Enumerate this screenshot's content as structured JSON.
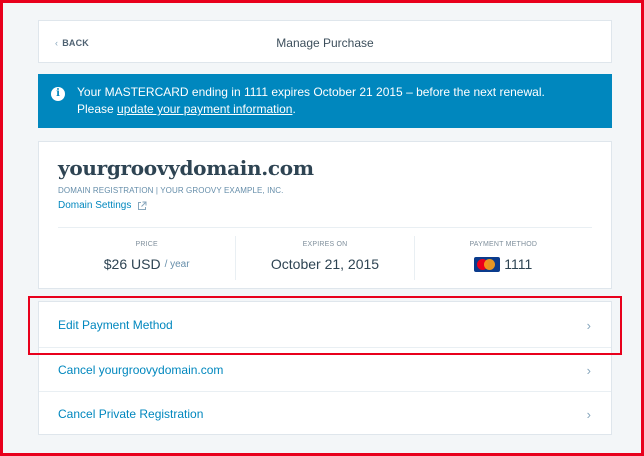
{
  "header": {
    "back_label": "BACK",
    "title": "Manage Purchase"
  },
  "notice": {
    "line1": "Your MASTERCARD ending in 1111 expires October 21 2015 – before the next renewal.",
    "line2_prefix": "Please ",
    "line2_link": "update your payment information",
    "line2_suffix": "."
  },
  "domain": {
    "name": "yourgroovydomain.com",
    "subtitle": "DOMAIN REGISTRATION | YOUR GROOVY EXAMPLE, INC.",
    "settings_link": "Domain Settings"
  },
  "stats": {
    "price_label": "PRICE",
    "price_value": "$26 USD",
    "price_period": "/ year",
    "expires_label": "EXPIRES ON",
    "expires_value": "October 21, 2015",
    "payment_label": "PAYMENT METHOD",
    "payment_value": "1111"
  },
  "options": [
    {
      "label": "Edit Payment Method"
    },
    {
      "label": "Cancel yourgroovydomain.com"
    },
    {
      "label": "Cancel Private Registration"
    }
  ],
  "colors": {
    "accent": "#0087be",
    "highlight": "#e8001c",
    "background": "#f3f6f8"
  },
  "icons": {
    "back": "chevron-left-icon",
    "info": "info-icon",
    "external": "external-link-icon",
    "card": "mastercard-icon",
    "arrow": "chevron-right-icon"
  }
}
